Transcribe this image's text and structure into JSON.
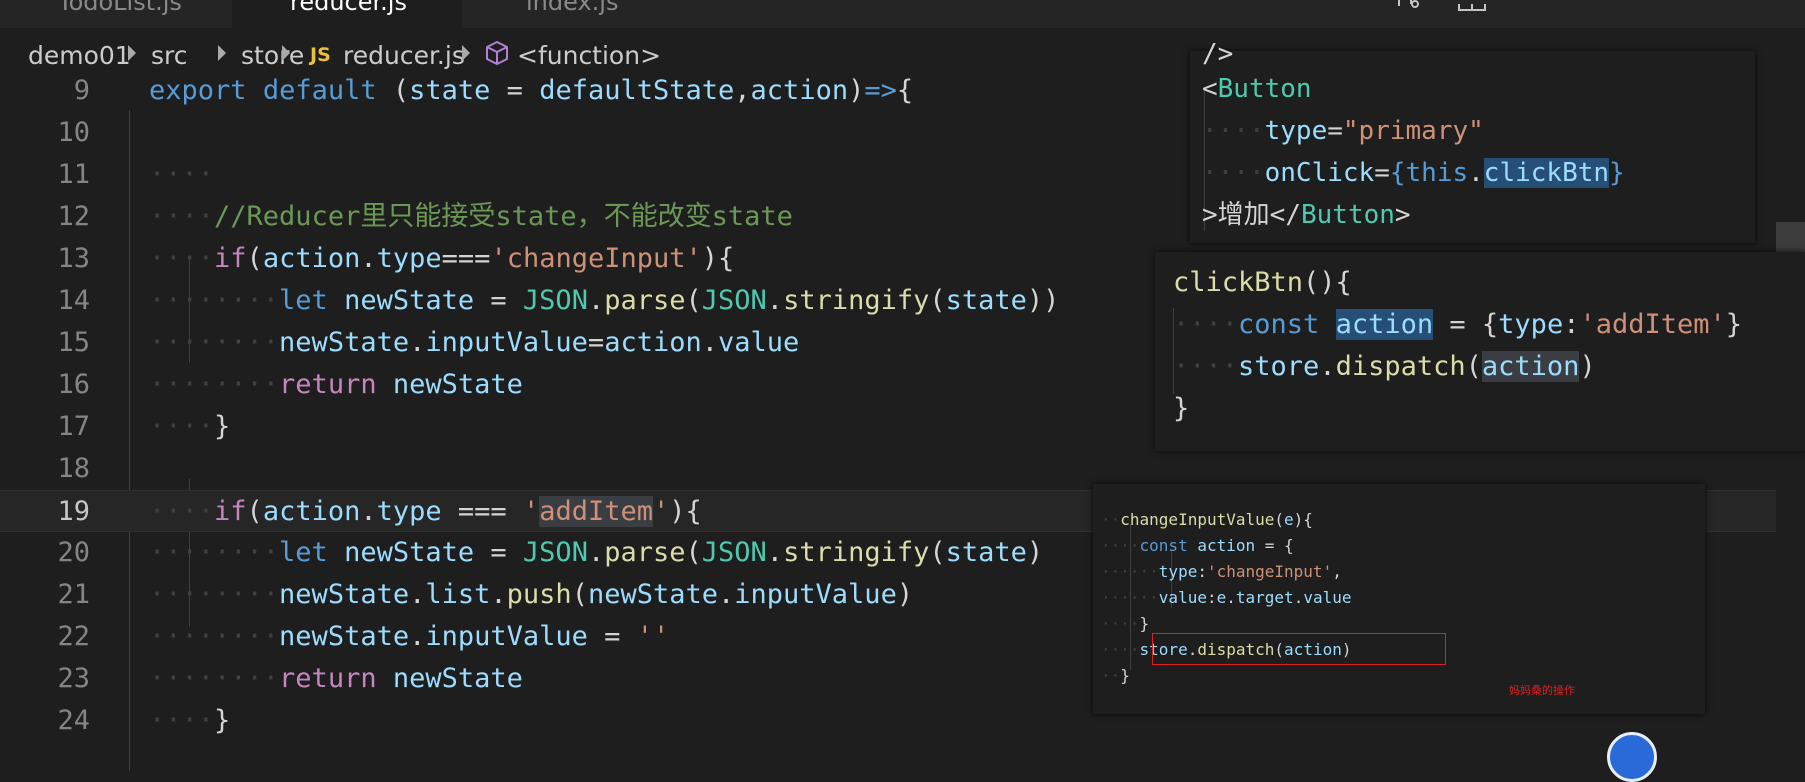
{
  "tabs": [
    "TodoList.js",
    "reducer.js",
    "index.js"
  ],
  "breadcrumb": {
    "folder1": "demo01",
    "folder2": "src",
    "folder3": "store",
    "file_badge": "JS",
    "file": "reducer.js",
    "symbol": "<function>"
  },
  "lines": [
    {
      "n": "9"
    },
    {
      "n": "10"
    },
    {
      "n": "11"
    },
    {
      "n": "12"
    },
    {
      "n": "13"
    },
    {
      "n": "14"
    },
    {
      "n": "15"
    },
    {
      "n": "16"
    },
    {
      "n": "17"
    },
    {
      "n": "18"
    },
    {
      "n": "19"
    },
    {
      "n": "20"
    },
    {
      "n": "21"
    },
    {
      "n": "22"
    },
    {
      "n": "23"
    },
    {
      "n": "24"
    }
  ],
  "code": {
    "l9": [
      "export",
      "default",
      "(",
      "state",
      " = ",
      "defaultState",
      ",",
      "action",
      ")",
      "=>",
      "{"
    ],
    "l12": "//Reducer里只能接受state，不能改变state",
    "l13": [
      "if",
      "(",
      "action",
      ".",
      "type",
      "===",
      "'changeInput'",
      "){"
    ],
    "l14": [
      "let",
      "newState",
      " = ",
      "JSON",
      ".",
      "parse",
      "(",
      "JSON",
      ".",
      "stringify",
      "(",
      "state",
      "))"
    ],
    "l15": [
      "newState",
      ".",
      "inputValue",
      "=",
      "action",
      ".",
      "value"
    ],
    "l16": [
      "return",
      "newState"
    ],
    "l17": "}",
    "l19": [
      "if",
      "(",
      "action",
      ".",
      "type",
      " === ",
      "'",
      "addItem",
      "'",
      "){"
    ],
    "l20": [
      "let",
      "newState",
      " = ",
      "JSON",
      ".",
      "parse",
      "(",
      "JSON",
      ".",
      "stringify",
      "(",
      "state",
      ")"
    ],
    "l21": [
      "newState",
      ".",
      "list",
      ".",
      "push",
      "(",
      "newState",
      ".",
      "inputValue",
      ")"
    ],
    "l22": [
      "newState",
      ".",
      "inputValue",
      " = ",
      "''"
    ],
    "l23": [
      "return",
      "newState"
    ],
    "l24": "}"
  },
  "overlay1": {
    "l0": "/>",
    "l1": [
      "<",
      "Button"
    ],
    "l2": [
      "type",
      "=",
      "\"primary\""
    ],
    "l3": [
      "onClick",
      "=",
      "{",
      "this",
      ".",
      "clickBtn",
      "}"
    ],
    "l4": [
      ">",
      "增加",
      "</",
      "Button",
      ">"
    ]
  },
  "overlay2": {
    "l1": [
      "clickBtn",
      "(){"
    ],
    "l2": [
      "const",
      "action",
      " = ",
      "{",
      "type",
      ":",
      "'addItem'",
      "}"
    ],
    "l3": [
      "store",
      ".",
      "dispatch",
      "(",
      "action",
      ")"
    ],
    "l4": "}"
  },
  "overlay3": {
    "l1": [
      "changeInputValue",
      "(",
      "e",
      "){"
    ],
    "l2": [
      "const",
      "action",
      " = ",
      "{"
    ],
    "l3": [
      "type",
      ":",
      "'changeInput'",
      ","
    ],
    "l4": [
      "value",
      ":",
      "e",
      ".",
      "target",
      ".",
      "value"
    ],
    "l5": "}",
    "l6": [
      "store",
      ".",
      "dispatch",
      "(",
      "action",
      ")"
    ],
    "l7": "}",
    "note": "妈妈桑的操作"
  },
  "colors": {
    "keyword": "#569cd6",
    "control": "#c586c0",
    "variable": "#9cdcfe",
    "function": "#dcdcaa",
    "class": "#4ec9b0",
    "string": "#ce9178",
    "comment": "#6a9955",
    "annotation": "#e02020"
  }
}
